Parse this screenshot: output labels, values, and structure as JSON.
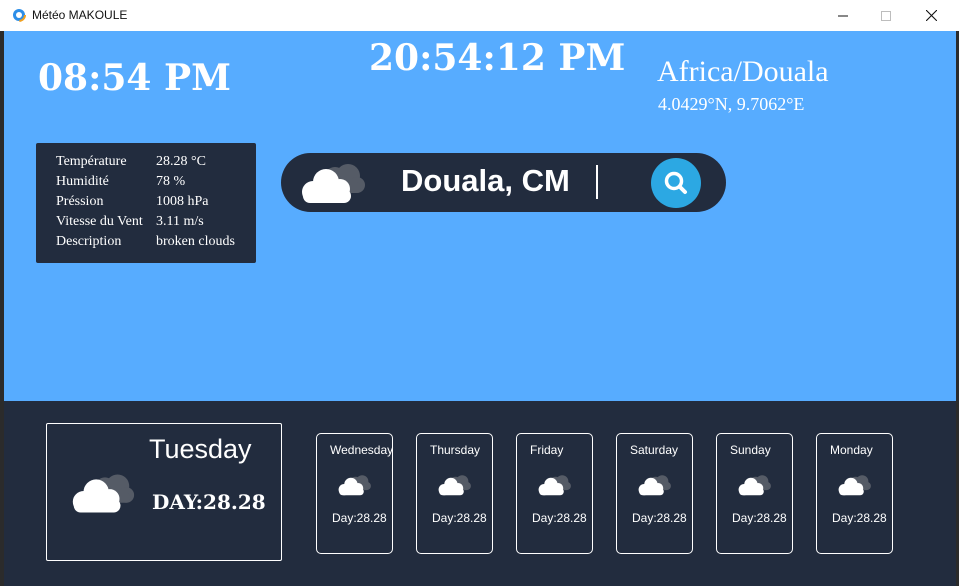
{
  "window": {
    "title": "Météo MAKOULE",
    "controls": {
      "minimize": "minimize-icon",
      "maximize": "maximize-icon",
      "close": "close-icon"
    }
  },
  "header": {
    "local_time": "08:54 PM",
    "clock": "20:54:12 PM",
    "timezone": "Africa/Douala",
    "coordinates": "4.0429°N, 9.7062°E"
  },
  "details": {
    "rows": [
      {
        "label": "Température",
        "value": "28.28 °C"
      },
      {
        "label": "Humidité",
        "value": "78 %"
      },
      {
        "label": "Préssion",
        "value": "1008 hPa"
      },
      {
        "label": "Vitesse du Vent",
        "value": "3.11 m/s"
      },
      {
        "label": "Description",
        "value": "broken clouds"
      }
    ]
  },
  "search": {
    "value": "Douala, CM",
    "button_icon": "search-icon"
  },
  "today": {
    "day": "Tuesday",
    "temp": "DAY:28.28",
    "icon": "cloud-icon"
  },
  "forecast": [
    {
      "day": "Wednesday",
      "temp": "Day:28.28"
    },
    {
      "day": "Thursday",
      "temp": "Day:28.28"
    },
    {
      "day": "Friday",
      "temp": "Day:28.28"
    },
    {
      "day": "Saturday",
      "temp": "Day:28.28"
    },
    {
      "day": "Sunday",
      "temp": "Day:28.28"
    },
    {
      "day": "Monday",
      "temp": "Day:28.28"
    }
  ],
  "colors": {
    "sky": "#57acff",
    "panel": "#222c3e",
    "accent": "#2ca8e3"
  }
}
